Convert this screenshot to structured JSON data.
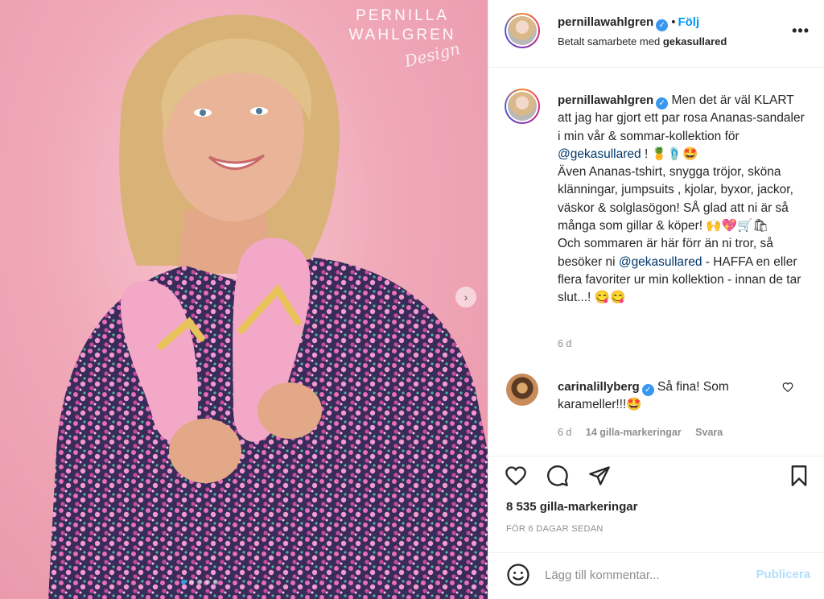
{
  "photo": {
    "brand_line1": "PERNILLA",
    "brand_line2": "WAHLGREN",
    "brand_script": "Design",
    "next_icon": "chevron-right-icon"
  },
  "header": {
    "username": "pernillawahlgren",
    "separator": "•",
    "follow_label": "Följ",
    "paid_prefix": "Betalt samarbete med",
    "partner": "gekasullared",
    "more_icon": "ellipsis-icon"
  },
  "caption": {
    "username": "pernillawahlgren",
    "text_part1": "Men det är väl KLART att jag har gjort ett par rosa Ananas-sandaler i min vår & sommar-kollektion för ",
    "mention1": "@gekasullared",
    "text_part2": " ! 🍍🩴🤩\nÄven Ananas-tshirt, snygga tröjor, sköna klänningar, jumpsuits , kjolar, byxor, jackor, väskor & solglasögon! SÅ glad att ni är så många som gillar & köper! 🙌💖🛒🛍\nOch sommaren är här förr än ni tror, så besöker ni ",
    "mention2": "@gekasullared",
    "text_part3": " - HAFFA en eller flera favoriter ur min kollektion - innan de tar slut...! 😋😋",
    "time": "6 d"
  },
  "reply": {
    "username": "carinalillyberg",
    "text": "Så fina! Som karameller!!!🤩",
    "time": "6 d",
    "likes": "14 gilla-markeringar",
    "reply_label": "Svara"
  },
  "actions": {
    "likes": "8 535 gilla-markeringar",
    "ago": "FÖR 6 DAGAR SEDAN"
  },
  "comment_bar": {
    "placeholder": "Lägg till kommentar...",
    "publish_label": "Publicera"
  },
  "colors": {
    "accent": "#0095f6",
    "verified": "#3897f0",
    "publish_disabled": "#b2dffc",
    "photo_bg": "#f0a9b8"
  }
}
